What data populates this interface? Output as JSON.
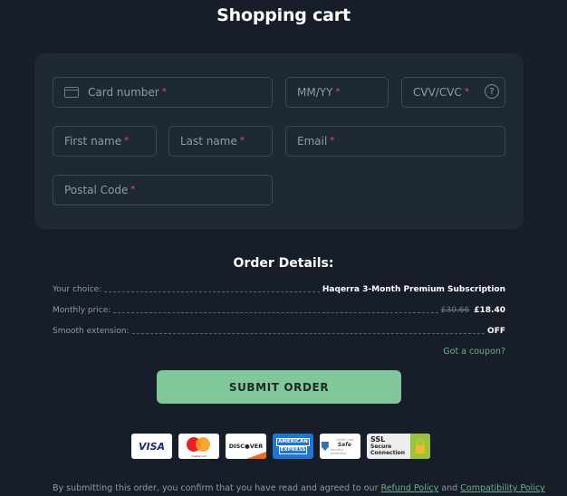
{
  "header": {
    "title": "Shopping cart"
  },
  "form": {
    "card_number": {
      "placeholder": "Card number",
      "required_mark": "*"
    },
    "expiry": {
      "placeholder": "MM/YY",
      "required_mark": "*"
    },
    "cvv": {
      "placeholder": "CVV/CVC",
      "required_mark": "*",
      "help_glyph": "?"
    },
    "first_name": {
      "placeholder": "First name",
      "required_mark": "*"
    },
    "last_name": {
      "placeholder": "Last name",
      "required_mark": "*"
    },
    "email": {
      "placeholder": "Email",
      "required_mark": "*"
    },
    "postal_code": {
      "placeholder": "Postal Code",
      "required_mark": "*"
    }
  },
  "order": {
    "title": "Order Details:",
    "rows": [
      {
        "label": "Your choice:",
        "value": "Haqerra 3-Month Premium Subscription"
      },
      {
        "label": "Monthly price:",
        "old_value": "£30.66",
        "value": "£18.40"
      },
      {
        "label": "Smooth extension:",
        "value": "OFF"
      }
    ],
    "coupon_link": "Got a coupon?"
  },
  "submit": {
    "label": "SUBMIT ORDER"
  },
  "payment_badges": {
    "visa": "VISA",
    "mastercard": "mastercard",
    "discover": "DISC●VER",
    "amex_line1": "AMERICAN",
    "amex_line2": "EXPRESS",
    "safe_top": "Credit Card",
    "safe_main": "Safe",
    "safe_bottom": "security protected",
    "ssl_line1": "SSL",
    "ssl_line2": "Secure",
    "ssl_line3": "Connection"
  },
  "footer": {
    "text": "By submitting this order, you confirm that you have read and agreed to our",
    "refund_link": "Refund Policy",
    "and": "and",
    "compat_link": "Compatibility Policy"
  },
  "colors": {
    "background": "#171e2a",
    "panel": "#1e2935",
    "accent_green": "#82c79a",
    "link_green": "#6fae86",
    "required_red": "#e0506a"
  }
}
